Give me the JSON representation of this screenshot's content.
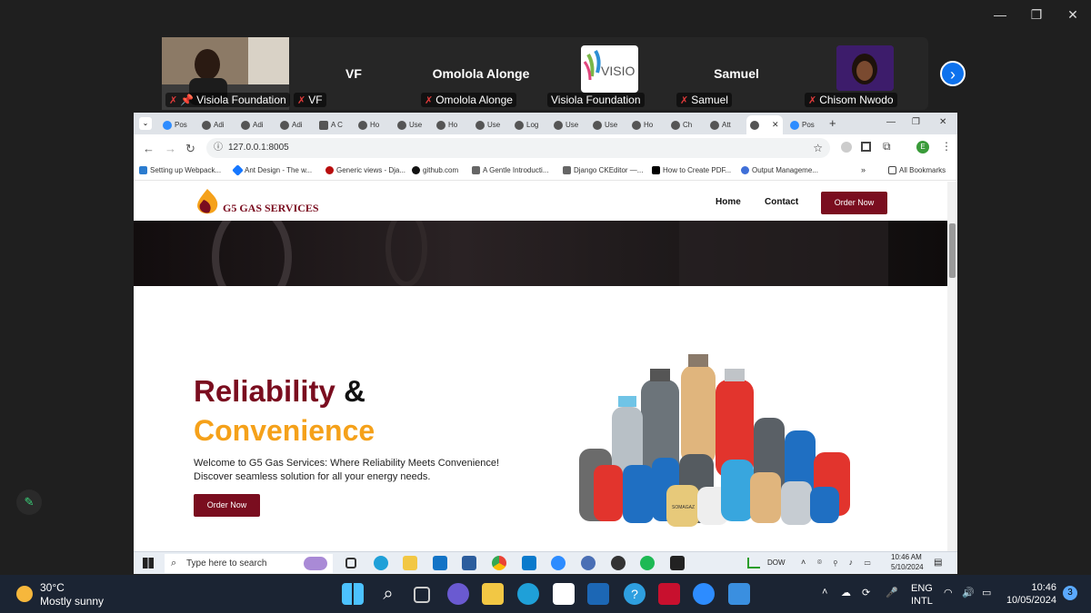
{
  "participants": [
    {
      "display": "",
      "label": "Visiola Foundation",
      "pinned": true
    },
    {
      "display": "VF",
      "label": "VF"
    },
    {
      "display": "Omolola Alonge",
      "label": "Omolola Alonge"
    },
    {
      "display": "",
      "label": "Visiola Foundation",
      "logo_text": "VISIO"
    },
    {
      "display": "Samuel",
      "label": "Samuel"
    },
    {
      "display": "",
      "label": "Chisom Nwodo"
    }
  ],
  "browser": {
    "tabs": [
      "Pos",
      "Adi",
      "Adi",
      "Adi",
      "A C",
      "Ho",
      "Use",
      "Ho",
      "Use",
      "Log",
      "Use",
      "Use",
      "Ho",
      "Ch",
      "Att",
      "",
      "Pos"
    ],
    "url": "127.0.0.1:8005",
    "profile": "E",
    "bookmarks": [
      "Setting up Webpack...",
      "Ant Design - The w...",
      "Generic views - Dja...",
      "github.com",
      "A Gentle Introducti...",
      "Django CKEditor —...",
      "How to Create PDF...",
      "Output Manageme...",
      "All Bookmarks"
    ]
  },
  "site": {
    "logo_text": "G5 GAS SERVICES",
    "nav": {
      "home": "Home",
      "contact": "Contact",
      "order": "Order Now"
    },
    "hero": {
      "title_word1": "Reliability",
      "title_amp": "&",
      "title_word2": "Convenience",
      "text": "Welcome to G5 Gas Services: Where Reliability Meets Convenience! Discover seamless solution for all your energy needs.",
      "button": "Order Now",
      "cylinder_label": "SOMAGAZ"
    }
  },
  "inner_taskbar": {
    "search_placeholder": "Type here to search",
    "stock": "DOW",
    "time": "10:46 AM",
    "date": "5/10/2024"
  },
  "taskbar": {
    "weather_temp": "30°C",
    "weather_desc": "Mostly sunny",
    "lang1": "ENG",
    "lang2": "INTL",
    "time": "10:46",
    "date": "10/05/2024",
    "notifications": "3"
  },
  "colors": {
    "brand": "#7a0d1f",
    "accent": "#f5a11a",
    "zoom_blue": "#0e72ed"
  }
}
